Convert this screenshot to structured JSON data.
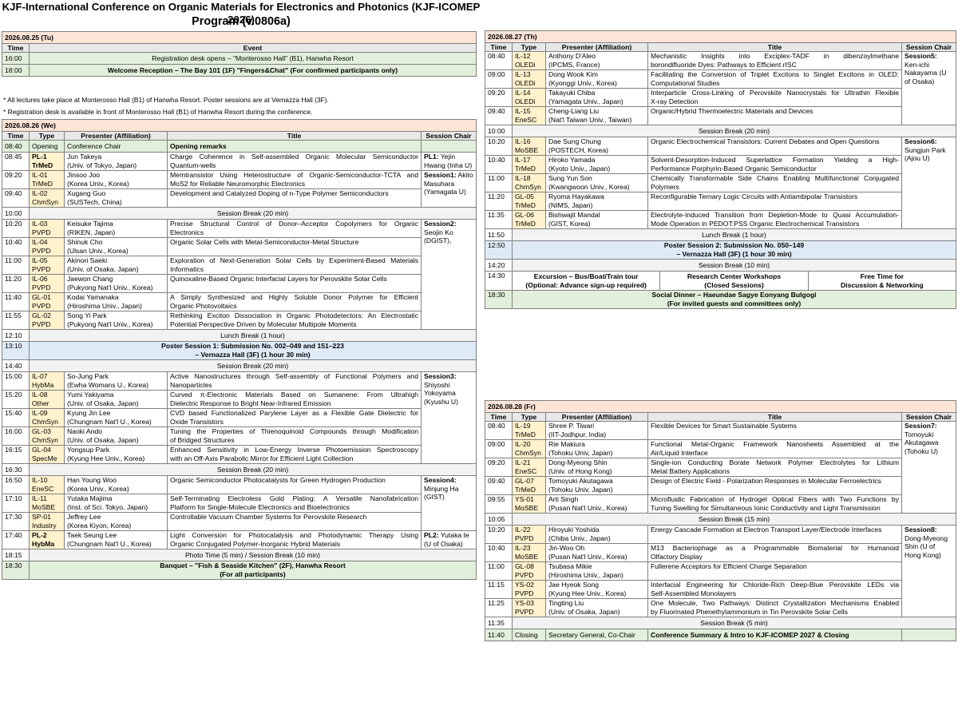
{
  "title": "KJF-International Conference on Organic Materials for Electronics and Photonics (KJF-ICOMEP 2026)",
  "subtitle": "Program (v.0806a)",
  "notes": [
    "* All lectures take place at Monterosso Hall (B1) of Hanwha Resort. Poster sessions are at Vernazza Hall (3F).",
    "* Registration desk is available in front of Monterosso Hall (B1) of Hanwha Resort during the conference."
  ],
  "headers": {
    "time": "Time",
    "type": "Type",
    "presenter": "Presenter (Affiliation)",
    "title": "Title",
    "chair": "Session Chair",
    "event": "Event"
  },
  "day0": {
    "date": "2026.08.25 (Tu)",
    "rows": [
      {
        "time": "16:00",
        "event": "Registration desk opens – \"Monterosso Hall\" (B1), Hanwha Resort"
      },
      {
        "time": "18:00",
        "event": "Welcome Reception – The Bay 101 (1F) \"Fingers&Chat\"      (For confirmed participants only)"
      }
    ]
  },
  "day1": {
    "date": "2026.08.26 (We)",
    "rows": [
      {
        "time": "08:40",
        "type": "Opening",
        "p1": "Conference Chair",
        "p2": "",
        "title": "Opening remarks",
        "t2": ""
      },
      {
        "time": "08:45",
        "type": "PL-1",
        "type2": "TrMeD",
        "p1": "Jun Takeya",
        "p2": "(Univ. of Tokyo, Japan)",
        "title": "Charge Coherence in Self-assembled Organic Molecular Semiconductor",
        "t2": "Quantum-wells"
      },
      {
        "time": "09:20",
        "type": "IL-01",
        "type2": "TrMeD",
        "p1": "Jinsoo Joo",
        "p2": "(Korea Univ., Korea)",
        "title": "Memtransistor Using Heterostructure of Organic-Semiconductor-TCTA and",
        "t2": "MoS2 for Reliable Neuromorphic Electronics"
      },
      {
        "time": "09:40",
        "type": "IL-02",
        "type2": "ChmSyn",
        "p1": "Xugang Guo",
        "p2": "(SUSTech, China)",
        "title": "Development and Catalyzed Doping of n-Type Polymer Semiconductors",
        "t2": ""
      },
      {
        "time": "10:00",
        "break": "Session Break (20 min)"
      },
      {
        "time": "10:20",
        "type": "IL-03",
        "type2": "PVPD",
        "p1": "Keisuke Tajima",
        "p2": "(RIKEN, Japan)",
        "title": "Precise Structural Control of Donor–Acceptor Copolymers for Organic",
        "t2": "Electronics"
      },
      {
        "time": "10:40",
        "type": "IL-04",
        "type2": "PVPD",
        "p1": "Shinuk Cho",
        "p2": "(Ulsan Univ., Korea)",
        "title": "Organic Solar Cells with Metal-Semiconductor-Metal Structure",
        "t2": ""
      },
      {
        "time": "11:00",
        "type": "IL-05",
        "type2": "PVPD",
        "p1": "Akinori Saeki",
        "p2": "(Univ. of Osaka, Japan)",
        "title": "Exploration of Next-Generation Solar Cells by Experiment-Based Materials",
        "t2": "Informatics"
      },
      {
        "time": "11:20",
        "type": "IL-06",
        "type2": "PVPD",
        "p1": "Jaewon Chang",
        "p2": "(Pukyong Nat'l Univ., Korea)",
        "title": "Quinoxaline-Based Organic Interfacial Layers for Perovskite Solar Cells",
        "t2": ""
      },
      {
        "time": "11:40",
        "type": "GL-01",
        "type2": "PVPD",
        "p1": "Kodai Yamanaka",
        "p2": "(Hiroshima Univ., Japan)",
        "title": "A Simply Synthesized and Highly Soluble Donor Polymer for Efficient",
        "t2": "Organic Photovoltaics"
      },
      {
        "time": "11:55",
        "type": "GL-02",
        "type2": "PVPD",
        "p1": "Song Yi Park",
        "p2": "(Pukyong Nat'l Univ., Korea)",
        "title": "Rethinking Exciton Dissociation in Organic Photodetectors: An Electrostatic",
        "t2": "Potential Perspective Driven by Molecular Multipole Moments"
      },
      {
        "time": "12:10",
        "break": "Lunch Break (1 hour)"
      },
      {
        "time": "13:10",
        "poster1": "Poster Session 1:   Submission No. 002–049 and 151–223",
        "poster2": "– Vernazza Hall (3F)    (1 hour 30 min)"
      },
      {
        "time": "14:40",
        "break": "Session Break (20 min)"
      },
      {
        "time": "15:00",
        "type": "IL-07",
        "type2": "HybMa",
        "p1": "So-Jung Park",
        "p2": "(Ewha Womans U., Korea)",
        "title": "Active Nanostructures through Self-assembly of Functional Polymers and",
        "t2": "Nanoparticles"
      },
      {
        "time": "15:20",
        "type": "IL-08",
        "type2": "Other",
        "p1": "Yumi Yakiyama",
        "p2": "(Univ. of Osaka, Japan)",
        "title": "Curved π-Electronic Materials Based on Sumanene: From Ultrahigh",
        "t2": "Dielectric Response to Bright Near-Infrared Emission"
      },
      {
        "time": "15:40",
        "type": "IL-09",
        "type2": "ChmSyn",
        "p1": "Kyung Jin Lee",
        "p2": "(Chungnam Nat'l U., Korea)",
        "title": "CVD based Functionalized Parylene Layer as a Flexible Gate Dielectric for",
        "t2": "Oxide Transistors"
      },
      {
        "time": "16:00",
        "type": "GL-03",
        "type2": "ChmSyn",
        "p1": "Naoki Ando",
        "p2": "(Univ. of Osaka, Japan)",
        "title": "Tuning the Properties of Thienoquinoid Compounds through Modification",
        "t2": "of Bridged Structures"
      },
      {
        "time": "16:15",
        "type": "GL-04",
        "type2": "SpecMe",
        "p1": "Yongsup Park",
        "p2": "(Kyung Hee Univ., Korea)",
        "title": "Enhanced Sensitivity in Low-Energy Inverse Photoemission Spectroscopy",
        "t2": "with an Off-Axis Parabolic Mirror for Efficient Light Collection"
      },
      {
        "time": "16:30",
        "break": "Session Break (20 min)"
      },
      {
        "time": "16:50",
        "type": "IL-10",
        "type2": "EneSC",
        "p1": "Han Young Woo",
        "p2": "(Korea Univ., Korea)",
        "title": "Organic Semiconductor Photocatalysts for Green Hydrogen Production",
        "t2": ""
      },
      {
        "time": "17:10",
        "type": "IL-11",
        "type2": "MoSBE",
        "p1": "Yutaka Majima",
        "p2": "(Inst. of Sci. Tokyo, Japan)",
        "title": "Self-Terminating Electroless Gold Plating: A Versatile Nanofabrication",
        "t2": "Platform for Single-Molecule Electronics and Bioelectronics"
      },
      {
        "time": "17:30",
        "type": "SP-01",
        "type2": "Industry",
        "p1": "Jeffrey Lee",
        "p2": "(Korea Kiyon, Korea)",
        "title": "Controllable Vacuum Chamber Systems for Perovskite Research",
        "t2": ""
      },
      {
        "time": "17:40",
        "type": "PL-2",
        "type2": "HybMa",
        "p1": "Taek Seung Lee",
        "p2": "(Chungnam Nat'l U., Korea)",
        "title": "Light Conversion for Photocatalysis and Photodynamic Therapy Using",
        "t2": "Organic Conjugated Polymer-Inorganic Hybrid Materials"
      },
      {
        "time": "18:15",
        "break": "Photo Time (5 min) / Session Break (10 min)"
      },
      {
        "time": "18:30",
        "banq1": "Banquet – \"Fish & Seaside Kitchen\" (2F), Hanwha Resort",
        "banq2": "(For all participants)"
      }
    ],
    "chairs": [
      {
        "k": "PL1:",
        "v": "Yejin Hwang (Inha U)"
      },
      {
        "k": "Session1:",
        "v": "Akito Masuhara (Yamagata U)"
      },
      {
        "k": "Session2:",
        "v": "Seojin Ko (DGIST),"
      },
      {
        "k": "Session3:",
        "v": "Shiyoshi Yokoyama (Kyushu U)"
      },
      {
        "k": "Session4:",
        "v": "Minjung Ha (GIST)"
      },
      {
        "k": "PL2:",
        "v": "Yutaka Ie (U of Osaka)"
      }
    ]
  },
  "day2": {
    "date": "2026.08.27 (Th)",
    "rows": [
      {
        "time": "08:40",
        "type": "IL-12",
        "type2": "OLEDi",
        "p1": "Anthony D'Aleo",
        "p2": "(IPCMS, France)",
        "title": "Mechanistic Insights into Exciplex-TADF in dibenzoylmethane",
        "t2": "borondifluoride Dyes: Pathways to Efficient rISC"
      },
      {
        "time": "09:00",
        "type": "IL-13",
        "type2": "OLEDi",
        "p1": "Dong Wook Kim",
        "p2": "(Kyonggi Univ., Korea)",
        "title": "Facilitating the Conversion of Triplet Excitons to Singlet Excitons in OLED:",
        "t2": "Computational Studies"
      },
      {
        "time": "09:20",
        "type": "IL-14",
        "type2": "OLEDi",
        "p1": "Takayuki Chiba",
        "p2": "(Yamagata Univ., Japan)",
        "title": "Interparticle Cross-Linking of Perovskite Nanocrystals for Ultrathin Flexible",
        "t2": "X-ray Detection"
      },
      {
        "time": "09:40",
        "type": "IL-15",
        "type2": "EneSC",
        "p1": "Cheng-Liang Liu",
        "p2": "(Nat'l Taiwan Univ., Taiwan)",
        "title": "Organic/Hybrid Thermoelectric Materials and Devices",
        "t2": ""
      },
      {
        "time": "10:00",
        "break": "Session Break (20 min)"
      },
      {
        "time": "10:20",
        "type": "IL-16",
        "type2": "MoSBE",
        "p1": "Dae Sung Chung",
        "p2": "(POSTECH, Korea)",
        "title": "Organic Electrochemical Transistors: Current Debates and Open Questions",
        "t2": ""
      },
      {
        "time": "10:40",
        "type": "IL-17",
        "type2": "TrMeD",
        "p1": "Hiroko Yamada",
        "p2": "(Kyoto Univ., Japan)",
        "title": "Solvent-Desorption-Induced Superlattice Formation Yielding a High-",
        "t2": "Performance Porphyrin-Based Organic Semiconductor"
      },
      {
        "time": "11:00",
        "type": "IL-18",
        "type2": "ChmSyn",
        "p1": "Sung Yun Son",
        "p2": "(Kwangwoon Univ., Korea)",
        "title": "Chemically Transformable Side Chains Enabling Multifunctional Conjugated",
        "t2": "Polymers"
      },
      {
        "time": "11:20",
        "type": "GL-05",
        "type2": "TrMeD",
        "p1": "Ryoma Hayakawa",
        "p2": "(NIMS, Japan)",
        "title": "Reconfigurable Ternary Logic Circuits with Antiambipolar Transistors",
        "t2": ""
      },
      {
        "time": "11:35",
        "type": "GL-06",
        "type2": "TrMeD",
        "p1": "Bishwajit Mandal",
        "p2": "(GIST, Korea)",
        "title": "Electrolyte-Induced Transition from Depletion-Mode to Quasi Accumulation-",
        "t2": "Mode Operation in PEDOT:PSS Organic Electrochemical Transistors"
      },
      {
        "time": "11:50",
        "break": "Lunch Break (1 hour)"
      },
      {
        "time": "12:50",
        "poster1": "Poster Session 2:   Submission No. 050–149",
        "poster2": "– Vernazza Hall (3F)    (1 hour 30 min)"
      },
      {
        "time": "14:20",
        "break": "Session Break (10 min)"
      },
      {
        "time": "14:30",
        "exc": [
          [
            "Excursion – Bus/Boat/Train tour",
            "(Optional: Advance sign-up required)"
          ],
          [
            "Research Center Workshops",
            "(Closed Sessions)"
          ],
          [
            "Free Time for",
            "Discussion & Networking"
          ]
        ]
      },
      {
        "time": "18:30",
        "din1": "Social Dinner – Haeundae Sagye Eonyang Bulgogi",
        "din2": "(For invited guests and committees only)"
      }
    ],
    "chairs": [
      {
        "k": "Session5:",
        "v": "Ken-ichi Nakayama (U of Osaka)"
      },
      {
        "k": "Session6:",
        "v": "Sungjun Park (Ajou U)"
      }
    ]
  },
  "day3": {
    "date": "2026.08.28 (Fr)",
    "rows": [
      {
        "time": "08:40",
        "type": "IL-19",
        "type2": "TrMeD",
        "p1": "Shree P. Tiwari",
        "p2": "(IIT-Jodhpur, India)",
        "title": "Flexible Devices for Smart Sustainable Systems",
        "t2": ""
      },
      {
        "time": "09:00",
        "type": "IL-20",
        "type2": "ChmSyn",
        "p1": "Rie Makiura",
        "p2": "(Tohoku Univ, Japan)",
        "title": "Functional Metal-Organic Framework Nanosheets Assembled at the",
        "t2": "Air/Liquid Interface"
      },
      {
        "time": "09:20",
        "type": "IL-21",
        "type2": "EneSC",
        "p1": "Dong-Myeong Shin",
        "p2": "(Univ. of Hong Kong)",
        "title": "Single-ion Conducting Borate Network Polymer Electrolytes for Lithium",
        "t2": "Metal Battery Applications"
      },
      {
        "time": "09:40",
        "type": "GL-07",
        "type2": "TrMeD",
        "p1": "Tomoyuki Akutagawa",
        "p2": "(Tohoku Univ, Japan)",
        "title": "Design of Electric Field - Polarization Responses in Molecular Ferroelectrics",
        "t2": ""
      },
      {
        "time": "09:55",
        "type": "YS-01",
        "type2": "MoSBE",
        "p1": "Arti Singh",
        "p2": "(Pusan Nat'l Univ., Korea)",
        "title": "Microfluidic Fabrication of Hydrogel Optical Fibers with Two Functions by",
        "t2": "Tuning Swelling for Simultaneous Ionic Conductivity and Light Transmission"
      },
      {
        "time": "10:05",
        "break": "Session Break (15 min)"
      },
      {
        "time": "10:20",
        "type": "IL-22",
        "type2": "PVPD",
        "p1": "Hiroyuki Yoshida",
        "p2": "(Chiba Univ., Japan)",
        "title": "Energy Cascade Formation at Electron Transport Layer/Electrode Interfaces",
        "t2": ""
      },
      {
        "time": "10:40",
        "type": "IL-23",
        "type2": "MoSBE",
        "p1": "Jin-Woo Oh",
        "p2": "(Pusan Nat'l Univ., Korea)",
        "title": "M13 Bacteriophage as a Programmable Biomaterial for Humanoid",
        "t2": "Olfactory Display"
      },
      {
        "time": "11:00",
        "type": "GL-08",
        "type2": "PVPD",
        "p1": "Tsubasa Mikie",
        "p2": "(Hiroshima Univ., Japan)",
        "title": "Fullerene Acceptors for Efficient Charge Separation",
        "t2": ""
      },
      {
        "time": "11:15",
        "type": "YS-02",
        "type2": "PVPD",
        "p1": "Jae Hyeok Song",
        "p2": "(Kyung Hee Univ., Korea)",
        "title": "Interfacial Engineering for Chloride-Rich Deep-Blue Perovskite LEDs via",
        "t2": "Self-Assembled Monolayers"
      },
      {
        "time": "11:25",
        "type": "YS-03",
        "type2": "PVPD",
        "p1": "Tingting Liu",
        "p2": "(Univ. of Osaka, Japan)",
        "title": "One Molecule, Two Pathways: Distinct Crystallization Mechanisms Enabled",
        "t2": "by Fluorinated Phenethylammonium in Tin Perovskite Solar Cells"
      },
      {
        "time": "11:35",
        "break": "Session Break (5 min)"
      },
      {
        "time": "11:40",
        "type": "Closing",
        "p1": "Secretary General, Co-Chair",
        "p2": "",
        "title": "Conference Summary & Intro to KJF-ICOMEP 2027 & Closing",
        "t2": ""
      }
    ],
    "chairs": [
      {
        "k": "Session7:",
        "v": "Tomoyuki Akutagawa (Tohoku U)"
      },
      {
        "k": "Session8:",
        "v": "Dong-Myeong Shin (U of Hong Kong)"
      }
    ]
  }
}
